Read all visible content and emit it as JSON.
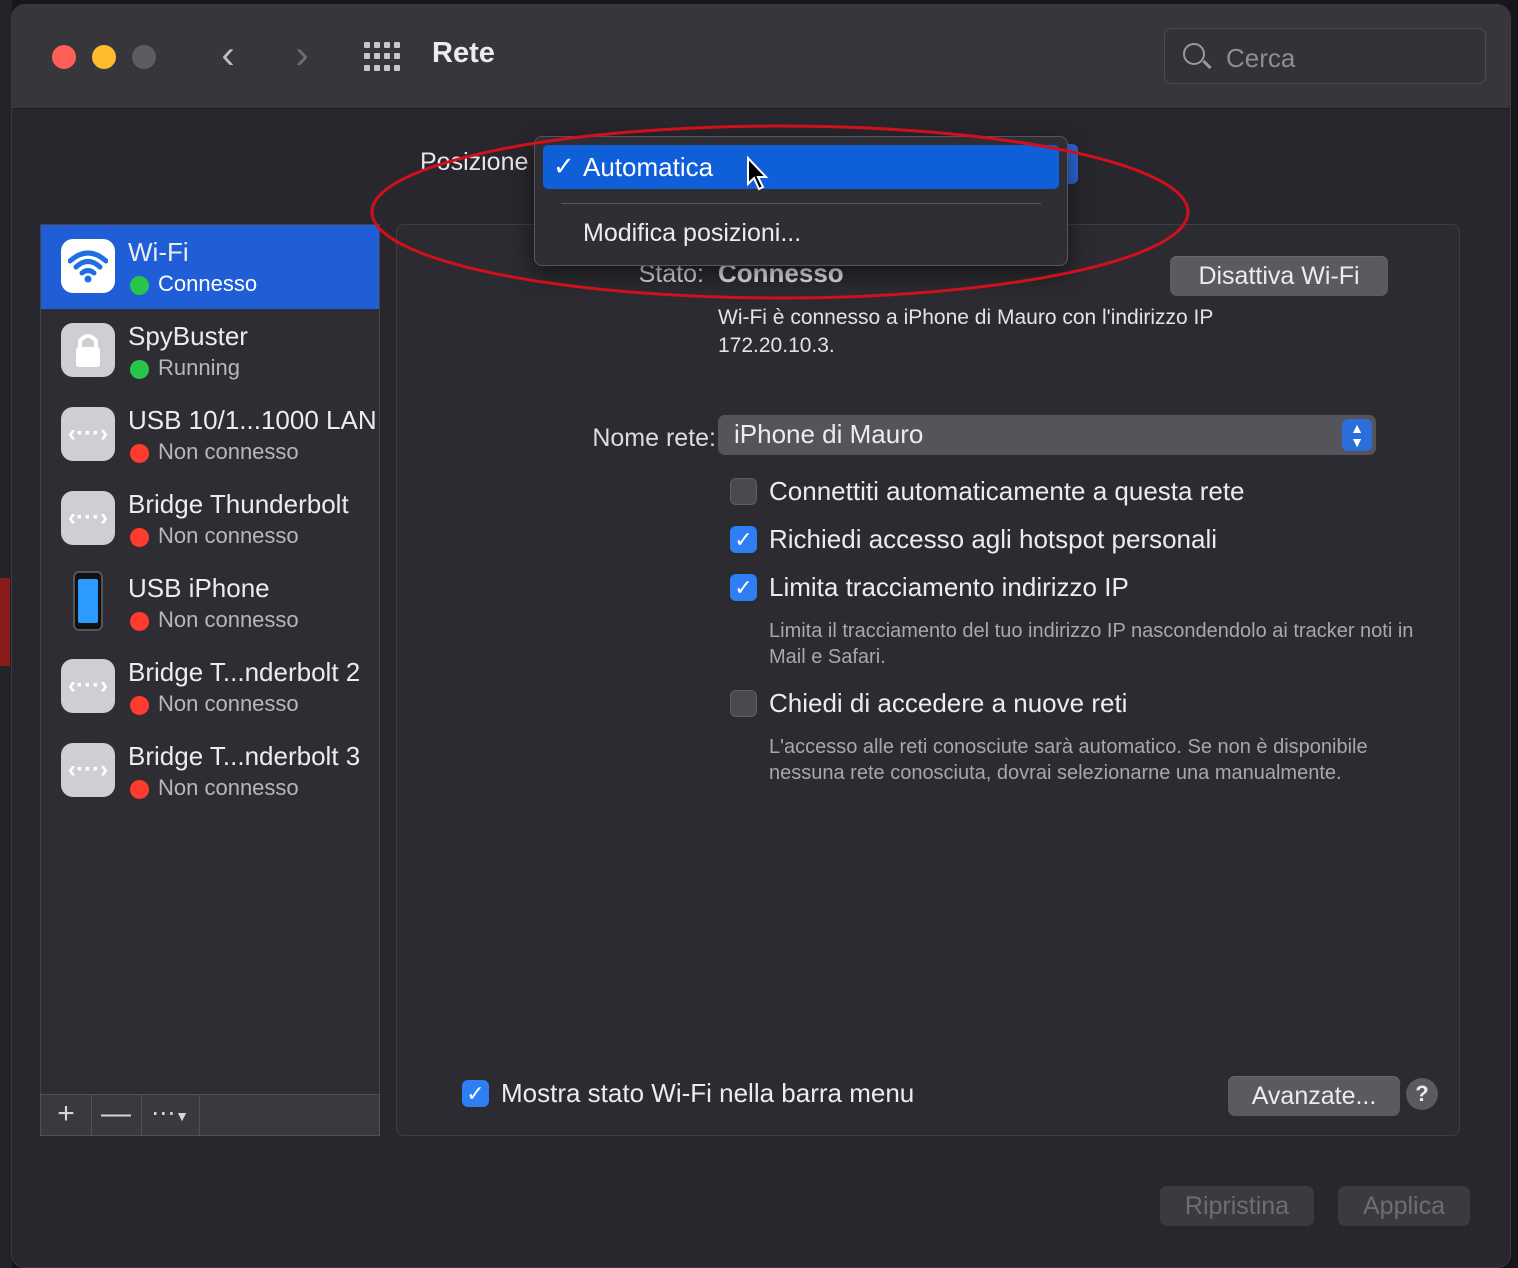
{
  "window": {
    "title": "Rete",
    "search_placeholder": "Cerca",
    "nav_back": "‹",
    "nav_forward": "›"
  },
  "location": {
    "label": "Posizione",
    "menu": {
      "selected": "Automatica",
      "checkmark": "✓",
      "items": [
        "Automatica",
        "Modifica posizioni..."
      ]
    }
  },
  "services": [
    {
      "name": "Wi-Fi",
      "status": "Connesso",
      "status_color": "#29c54a",
      "icon": "wifi-icon",
      "selected": true
    },
    {
      "name": "SpyBuster",
      "status": "Running",
      "status_color": "#29c54a",
      "icon": "lock-icon"
    },
    {
      "name": "USB 10/1...1000 LAN",
      "status": "Non connesso",
      "status_color": "#ff3b30",
      "icon": "ethernet-icon"
    },
    {
      "name": "Bridge Thunderbolt",
      "status": "Non connesso",
      "status_color": "#ff3b30",
      "icon": "ethernet-icon"
    },
    {
      "name": "USB iPhone",
      "status": "Non connesso",
      "status_color": "#ff3b30",
      "icon": "iphone-icon"
    },
    {
      "name": "Bridge T...nderbolt 2",
      "status": "Non connesso",
      "status_color": "#ff3b30",
      "icon": "ethernet-icon"
    },
    {
      "name": "Bridge T...nderbolt 3",
      "status": "Non connesso",
      "status_color": "#ff3b30",
      "icon": "ethernet-icon"
    }
  ],
  "sidebar_footer": {
    "add": "+",
    "remove": "—",
    "more": "⋯"
  },
  "detail": {
    "status_label": "Stato:",
    "status_value": "Connesso",
    "toggle_button": "Disattiva Wi-Fi",
    "info": "Wi-Fi è connesso a iPhone di Mauro con l'indirizzo IP 172.20.10.3.",
    "network_label": "Nome rete:",
    "network_value": "iPhone di Mauro",
    "options": [
      {
        "label": "Connettiti automaticamente a questa rete",
        "checked": false
      },
      {
        "label": "Richiedi accesso agli hotspot personali",
        "checked": true
      },
      {
        "label": "Limita tracciamento indirizzo IP",
        "checked": true
      },
      {
        "label": "Chiedi di accedere a nuove reti",
        "checked": false
      }
    ],
    "hint_ip": "Limita il tracciamento del tuo indirizzo IP nascondendolo ai tracker noti in Mail e Safari.",
    "hint_networks": "L'accesso alle reti conosciute sarà automatico. Se non è disponibile nessuna rete conosciuta, dovrai selezionarne una manualmente.",
    "show_status": {
      "label": "Mostra stato Wi-Fi nella barra menu",
      "checked": true
    },
    "advanced_button": "Avanzate...",
    "help_button": "?"
  },
  "footer": {
    "revert": "Ripristina",
    "apply": "Applica"
  },
  "annotation": {
    "color": "#d0101a"
  }
}
